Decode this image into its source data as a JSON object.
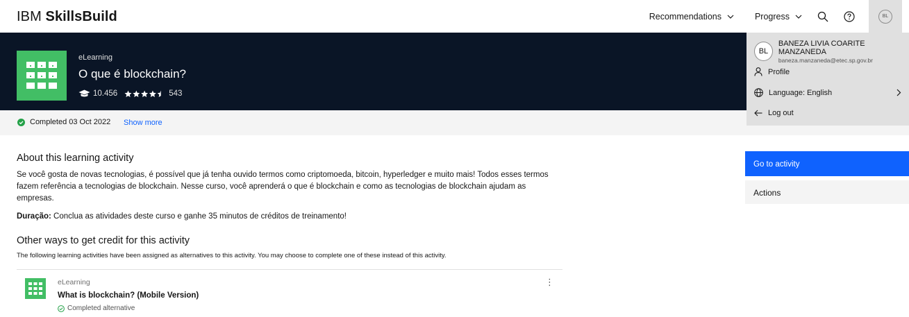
{
  "header": {
    "brand_light": "IBM ",
    "brand_bold": "SkillsBuild",
    "nav": {
      "recommendations": "Recommendations",
      "progress": "Progress"
    },
    "avatar_initials": "BL"
  },
  "course": {
    "type": "eLearning",
    "title": "O que é blockchain?",
    "learners": "10.456",
    "rating_count": "543",
    "rating_value": 4.5
  },
  "status": {
    "completed": "Completed 03 Oct 2022",
    "show_more": "Show more"
  },
  "about": {
    "heading": "About this learning activity",
    "description_1": "Se você gosta de novas tecnologias, é possível que já tenha ouvido termos como criptomoeda, bitcoin, hyperledger e muito mais! Todos esses termos",
    "description_2": "fazem referência a tecnologias de blockchain. Nesse curso, você aprenderá o que é blockchain e como as tecnologias de blockchain ajudam as empresas.",
    "duration_label": "Duração:",
    "duration_text": " Conclua as atividades deste curso e ganhe 35 minutos de créditos de treinamento!"
  },
  "alternatives": {
    "heading": "Other ways to get credit for this activity",
    "note": "The following learning activities have been assigned as alternatives to this activity. You may choose to complete one of these instead of this activity.",
    "items": [
      {
        "type": "eLearning",
        "title": "What is blockchain? (Mobile Version)",
        "status": "Completed alternative"
      }
    ]
  },
  "sidebar": {
    "go_to_activity": "Go to activity",
    "actions": "Actions"
  },
  "user_menu": {
    "initials": "BL",
    "name": "BANEZA LIVIA COARITE MANZANEDA",
    "email": "baneza.manzaneda@etec.sp.gov.br",
    "profile": "Profile",
    "language": "Language: English",
    "logout": "Log out"
  },
  "colors": {
    "accent_blue": "#0f62fe",
    "hero_bg": "#0a1526",
    "tile_green": "#42be65",
    "success_green": "#24a148"
  },
  "icons": [
    "search-icon",
    "help-icon",
    "user-icon",
    "globe-icon",
    "arrow-left-icon",
    "chevron-down-icon",
    "chevron-right-icon",
    "graduation-cap-icon",
    "star-icon",
    "checkmark-icon",
    "overflow-menu-icon"
  ]
}
